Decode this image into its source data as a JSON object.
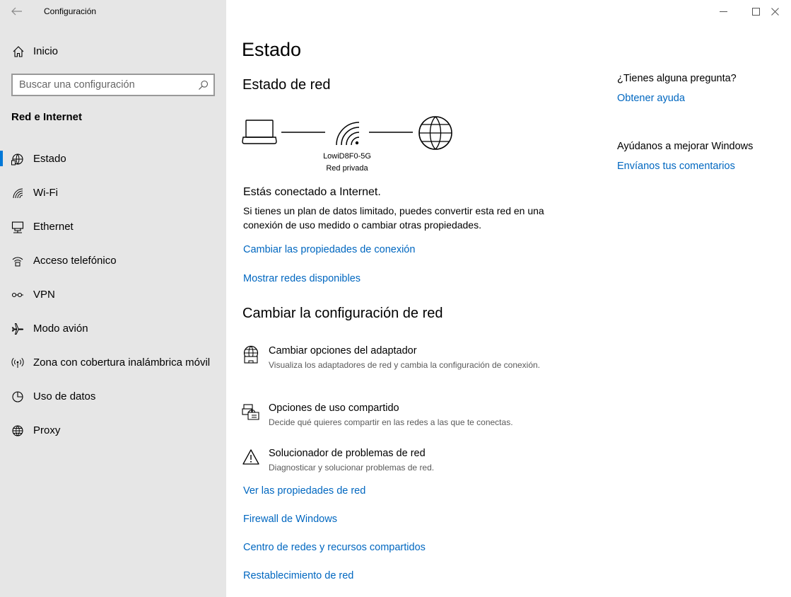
{
  "window": {
    "title": "Configuración"
  },
  "sidebar": {
    "home_label": "Inicio",
    "search_placeholder": "Buscar una configuración",
    "section_title": "Red e Internet",
    "items": [
      {
        "label": "Estado",
        "icon": "status-icon",
        "active": true
      },
      {
        "label": "Wi-Fi",
        "icon": "wifi-icon"
      },
      {
        "label": "Ethernet",
        "icon": "ethernet-icon"
      },
      {
        "label": "Acceso telefónico",
        "icon": "dialup-icon"
      },
      {
        "label": "VPN",
        "icon": "vpn-icon"
      },
      {
        "label": "Modo avión",
        "icon": "airplane-icon"
      },
      {
        "label": "Zona con cobertura inalámbrica móvil",
        "icon": "hotspot-icon"
      },
      {
        "label": "Uso de datos",
        "icon": "data-usage-icon"
      },
      {
        "label": "Proxy",
        "icon": "globe-icon"
      }
    ]
  },
  "main": {
    "title": "Estado",
    "network_status_heading": "Estado de red",
    "network": {
      "name": "LowiD8F0-5G",
      "type": "Red privada"
    },
    "connected_text": "Estás conectado a Internet.",
    "description": "Si tienes un plan de datos limitado, puedes convertir esta red en una conexión de uso medido o cambiar otras propiedades.",
    "links_top": [
      "Cambiar las propiedades de conexión",
      "Mostrar redes disponibles"
    ],
    "change_heading": "Cambiar la configuración de red",
    "options": [
      {
        "title": "Cambiar opciones del adaptador",
        "desc": "Visualiza los adaptadores de red y cambia la configuración de conexión.",
        "icon": "adapter-globe-icon"
      },
      {
        "title": "Opciones de uso compartido",
        "desc": "Decide qué quieres compartir en las redes a las que te conectas.",
        "icon": "sharing-icon"
      },
      {
        "title": "Solucionador de problemas de red",
        "desc": "Diagnosticar y solucionar problemas de red.",
        "icon": "warning-icon"
      }
    ],
    "links_bottom": [
      "Ver las propiedades de red",
      "Firewall de Windows",
      "Centro de redes y recursos compartidos",
      "Restablecimiento de red"
    ]
  },
  "right": {
    "question": "¿Tienes alguna pregunta?",
    "help_link": "Obtener ayuda",
    "improve": "Ayúdanos a mejorar Windows",
    "feedback_link": "Envíanos tus comentarios"
  },
  "colors": {
    "accent": "#0078d7",
    "link": "#0067c0",
    "sidebar_bg": "#e6e6e6"
  }
}
